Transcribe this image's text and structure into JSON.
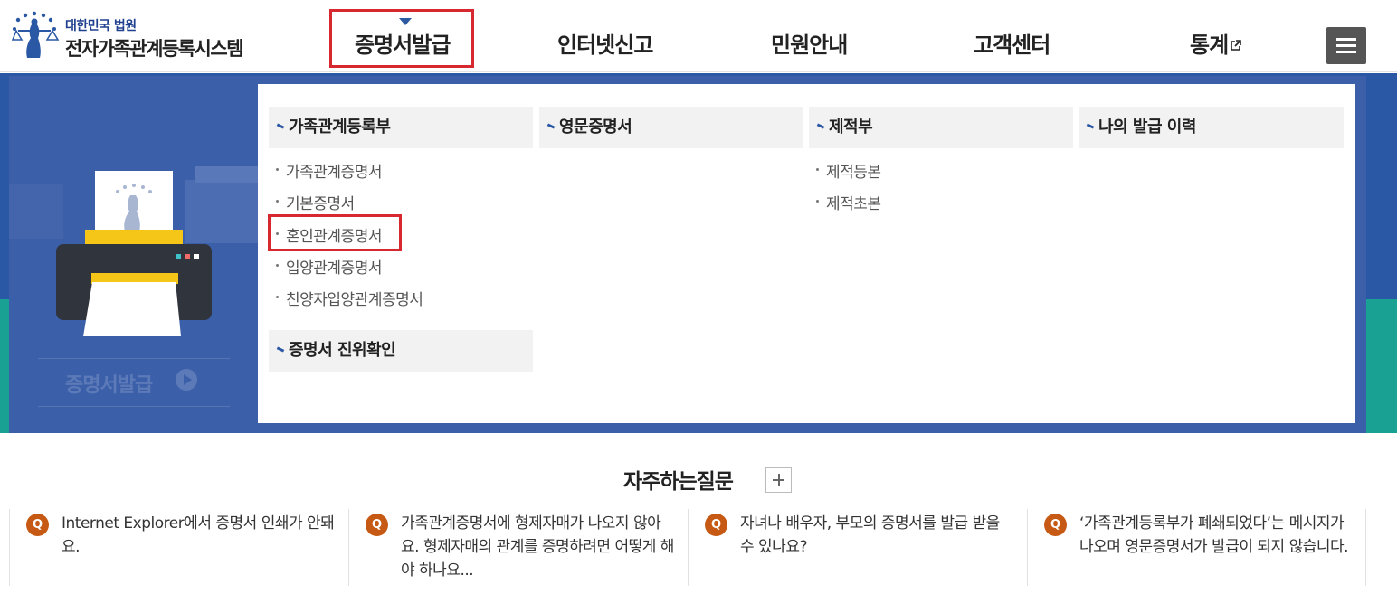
{
  "header": {
    "logo_small": "대한민국 법원",
    "logo_big": "전자가족관계등록시스템",
    "nav": [
      {
        "label": "증명서발급",
        "active": true
      },
      {
        "label": "인터넷신고"
      },
      {
        "label": "민원안내"
      },
      {
        "label": "고객센터"
      },
      {
        "label": "통계",
        "external": true
      }
    ],
    "menu_icon": "hamburger-icon"
  },
  "visual": {
    "label": "증명서발급",
    "play_icon": "play-circle-icon"
  },
  "dropdown": {
    "columns": [
      {
        "title": "가족관계등록부",
        "items": [
          "가족관계증명서",
          "기본증명서",
          "혼인관계증명서",
          "입양관계증명서",
          "친양자입양관계증명서"
        ],
        "highlighted_item": "혼인관계증명서"
      },
      {
        "title": "영문증명서",
        "items": []
      },
      {
        "title": "제적부",
        "items": [
          "제적등본",
          "제적초본"
        ]
      },
      {
        "title": "나의 발급 이력",
        "items": []
      }
    ],
    "extra_heading": "증명서 진위확인"
  },
  "faq": {
    "title": "자주하는질문",
    "plus_icon": "plus-icon",
    "badge": "Q",
    "items": [
      "Internet Explorer에서 증명서 인쇄가 안돼요.",
      "가족관계증명서에 형제자매가 나오지 않아요. 형제자매의 관계를 증명하려면 어떻게 해야 하나요...",
      "자녀나 배우자, 부모의 증명서를 발급 받을 수 있나요?",
      "‘가족관계등록부가 폐쇄되었다’는 메시지가 나오며 영문증명서가 발급이 되지 않습니다."
    ]
  },
  "colors": {
    "primary_blue": "#2a58a4",
    "teal": "#19a293",
    "highlight_red": "#d7282f",
    "faq_badge": "#c65a14"
  }
}
